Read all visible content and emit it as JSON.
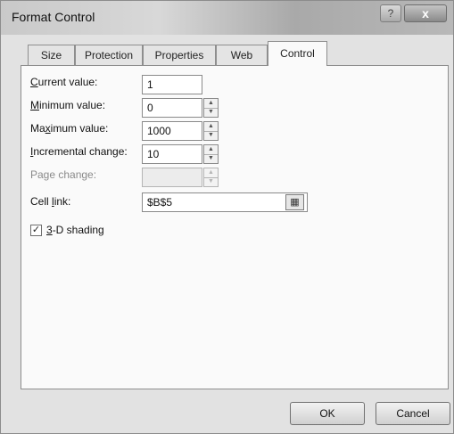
{
  "window": {
    "title": "Format Control",
    "help_label": "?",
    "close_label": "x"
  },
  "tabs": [
    {
      "label": "Size"
    },
    {
      "label": "Protection"
    },
    {
      "label": "Properties"
    },
    {
      "label": "Web"
    },
    {
      "label": "Control",
      "active": true
    }
  ],
  "fields": {
    "current": {
      "label_pre": "",
      "label_key": "C",
      "label_post": "urrent value:",
      "value": "1"
    },
    "minimum": {
      "label_pre": "",
      "label_key": "M",
      "label_post": "inimum value:",
      "value": "0"
    },
    "maximum": {
      "label_pre": "Ma",
      "label_key": "x",
      "label_post": "imum value:",
      "value": "1000"
    },
    "incremental": {
      "label_pre": "",
      "label_key": "I",
      "label_post": "ncremental change:",
      "value": "10"
    },
    "page": {
      "label": "Page change:",
      "value": ""
    },
    "cell_link": {
      "label_pre": "Cell ",
      "label_key": "l",
      "label_post": "ink:",
      "value": "$B$5",
      "ref_icon": "range-select-icon"
    }
  },
  "shading": {
    "checked": true,
    "check_glyph": "✓",
    "label_key": "3",
    "label_post": "-D shading"
  },
  "buttons": {
    "ok": "OK",
    "cancel": "Cancel"
  }
}
